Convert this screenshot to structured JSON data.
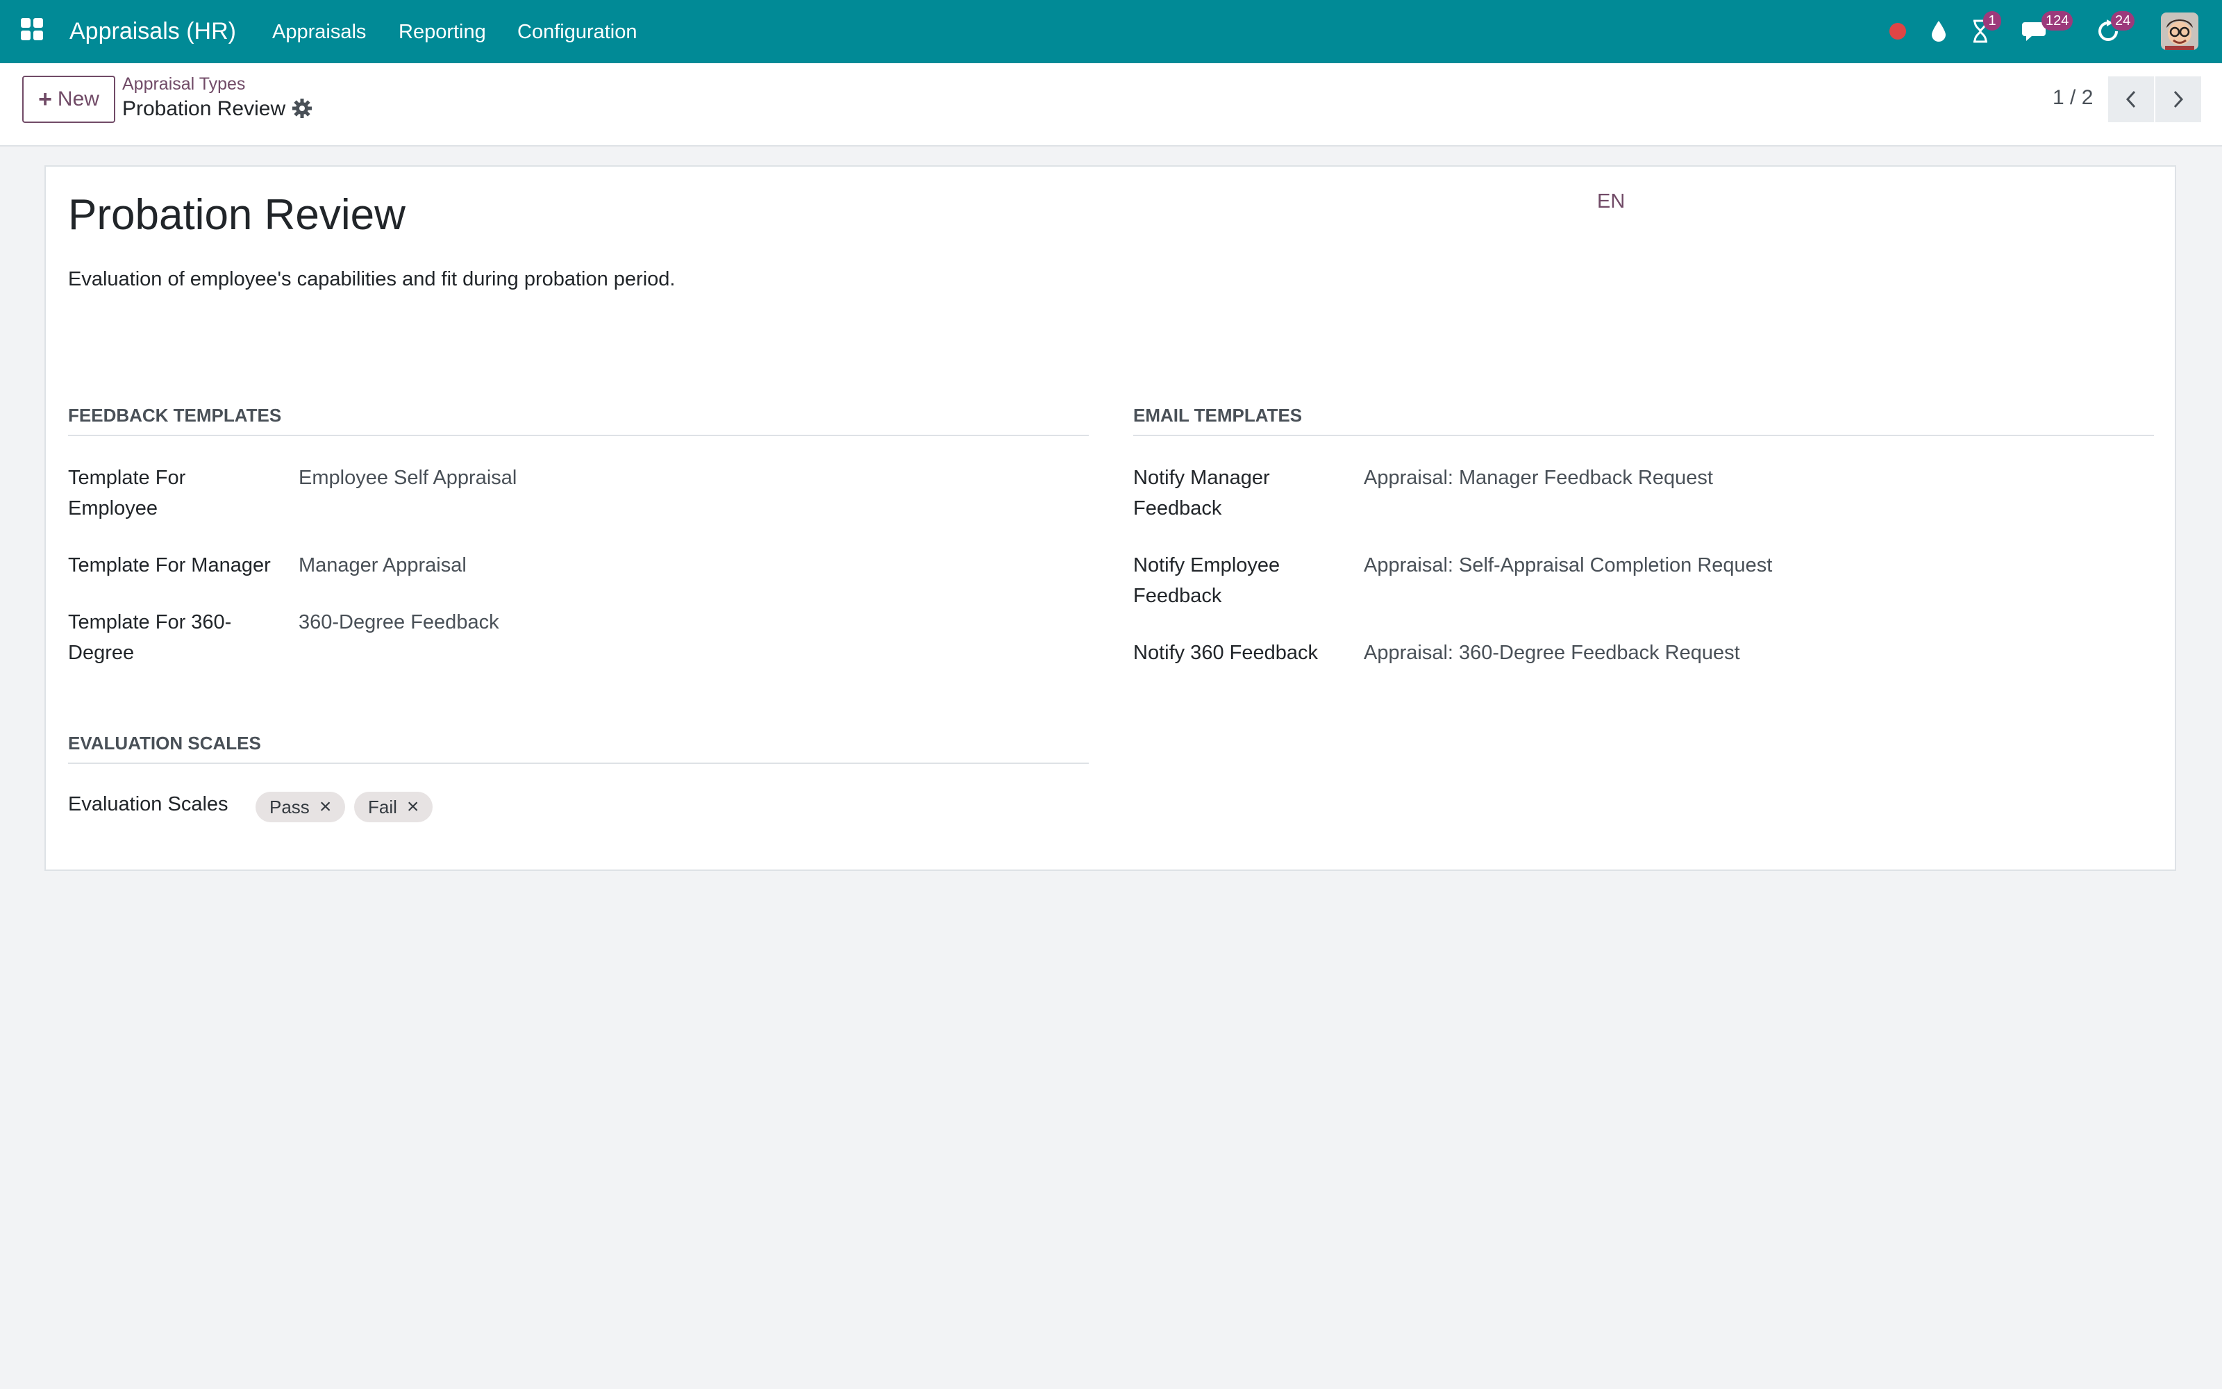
{
  "navbar": {
    "app_name": "Appraisals (HR)",
    "menu": [
      "Appraisals",
      "Reporting",
      "Configuration"
    ],
    "badges": {
      "activities": "1",
      "messages": "124",
      "updates": "24"
    },
    "colors": {
      "bar": "#018a96",
      "badge": "#9c3a7b",
      "record_dot": "#e04545"
    },
    "icons": [
      "apps-grid-icon",
      "record-icon",
      "drop-icon",
      "hourglass-icon",
      "chat-icon",
      "refresh-icon",
      "user-avatar"
    ]
  },
  "control": {
    "new_label": "New",
    "breadcrumb_parent": "Appraisal Types",
    "breadcrumb_current": "Probation Review",
    "pager": "1 / 2"
  },
  "form": {
    "title": "Probation Review",
    "lang": "EN",
    "description": "Evaluation of employee's capabilities and fit during probation period.",
    "feedback": {
      "title": "FEEDBACK TEMPLATES",
      "employee_label": "Template For Employee",
      "employee_value": "Employee Self Appraisal",
      "manager_label": "Template For Manager",
      "manager_value": "Manager Appraisal",
      "deg360_label": "Template For 360-Degree",
      "deg360_value": "360-Degree Feedback"
    },
    "email": {
      "title": "EMAIL TEMPLATES",
      "manager_label": "Notify Manager Feedback",
      "manager_value": "Appraisal: Manager Feedback Request",
      "employee_label": "Notify Employee Feedback",
      "employee_value": "Appraisal: Self-Appraisal Completion Request",
      "deg360_label": "Notify 360 Feedback",
      "deg360_value": "Appraisal: 360-Degree Feedback Request"
    },
    "scales": {
      "title": "EVALUATION SCALES",
      "label": "Evaluation Scales",
      "tags": [
        "Pass",
        "Fail"
      ]
    }
  }
}
